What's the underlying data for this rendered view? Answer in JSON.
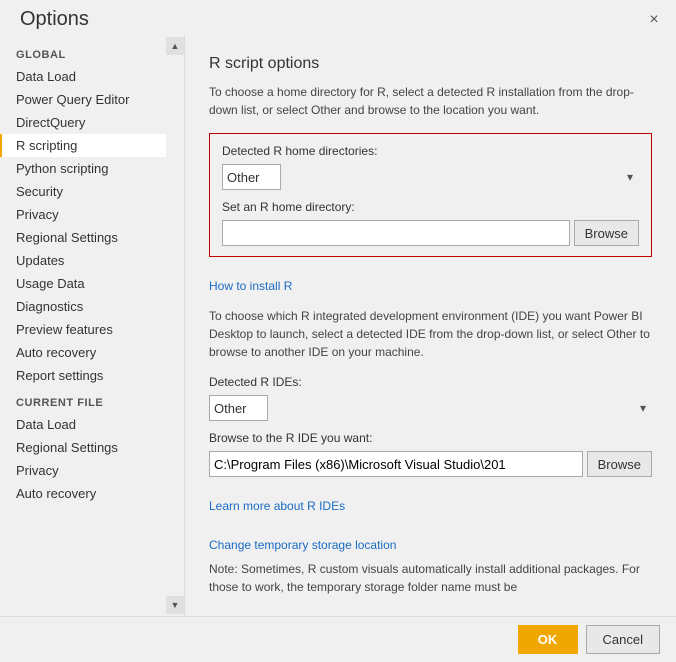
{
  "dialog": {
    "title": "Options",
    "close_label": "×"
  },
  "sidebar": {
    "global_label": "GLOBAL",
    "global_items": [
      {
        "id": "data-load",
        "label": "Data Load",
        "active": false
      },
      {
        "id": "power-query-editor",
        "label": "Power Query Editor",
        "active": false
      },
      {
        "id": "directquery",
        "label": "DirectQuery",
        "active": false
      },
      {
        "id": "r-scripting",
        "label": "R scripting",
        "active": true
      },
      {
        "id": "python-scripting",
        "label": "Python scripting",
        "active": false
      },
      {
        "id": "security",
        "label": "Security",
        "active": false
      },
      {
        "id": "privacy",
        "label": "Privacy",
        "active": false
      },
      {
        "id": "regional-settings",
        "label": "Regional Settings",
        "active": false
      },
      {
        "id": "updates",
        "label": "Updates",
        "active": false
      },
      {
        "id": "usage-data",
        "label": "Usage Data",
        "active": false
      },
      {
        "id": "diagnostics",
        "label": "Diagnostics",
        "active": false
      },
      {
        "id": "preview-features",
        "label": "Preview features",
        "active": false
      },
      {
        "id": "auto-recovery",
        "label": "Auto recovery",
        "active": false
      },
      {
        "id": "report-settings",
        "label": "Report settings",
        "active": false
      }
    ],
    "current_file_label": "CURRENT FILE",
    "current_file_items": [
      {
        "id": "cf-data-load",
        "label": "Data Load",
        "active": false
      },
      {
        "id": "cf-regional-settings",
        "label": "Regional Settings",
        "active": false
      },
      {
        "id": "cf-privacy",
        "label": "Privacy",
        "active": false
      },
      {
        "id": "cf-auto-recovery",
        "label": "Auto recovery",
        "active": false
      }
    ],
    "scroll_up": "▲",
    "scroll_down": "▼"
  },
  "content": {
    "title": "R script options",
    "description": "To choose a home directory for R, select a detected R installation from the drop-down list, or select Other and browse to the location you want.",
    "detected_home_label": "Detected R home directories:",
    "detected_home_value": "Other",
    "detected_home_options": [
      "Other"
    ],
    "set_home_label": "Set an R home directory:",
    "set_home_value": "",
    "set_home_placeholder": "",
    "browse_label": "Browse",
    "install_link": "How to install R",
    "ide_desc": "To choose which R integrated development environment (IDE) you want Power BI Desktop to launch, select a detected IDE from the drop-down list, or select Other to browse to another IDE on your machine.",
    "detected_ide_label": "Detected R IDEs:",
    "detected_ide_value": "Other",
    "detected_ide_options": [
      "Other"
    ],
    "browse_ide_label": "Browse to the R IDE you want:",
    "browse_ide_value": "C:\\Program Files (x86)\\Microsoft Visual Studio\\201",
    "browse_ide_btn": "Browse",
    "ide_link": "Learn more about R IDEs",
    "change_storage_link": "Change temporary storage location",
    "note_text": "Note: Sometimes, R custom visuals automatically install additional packages. For those to work, the temporary storage folder name must be"
  },
  "footer": {
    "ok_label": "OK",
    "cancel_label": "Cancel"
  }
}
